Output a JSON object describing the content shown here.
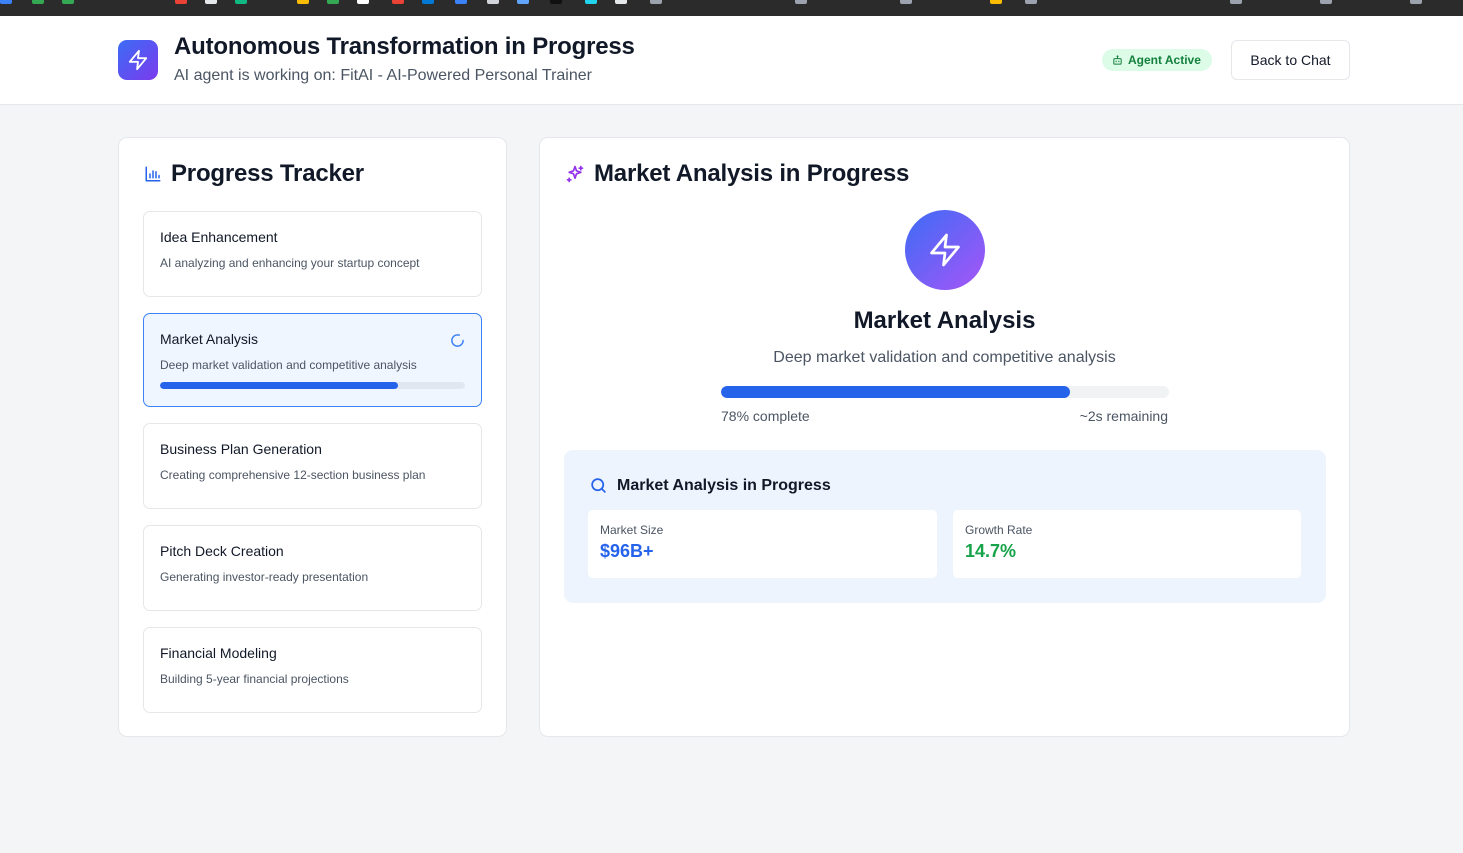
{
  "header": {
    "title": "Autonomous Transformation in Progress",
    "subtitle": "AI agent is working on: FitAI - AI-Powered Personal Trainer",
    "badge": "Agent Active",
    "back_button": "Back to Chat",
    "logo_icon": "lightning-icon",
    "badge_icon": "robot-icon"
  },
  "tracker": {
    "heading": "Progress Tracker",
    "heading_icon": "bar-chart-icon",
    "steps": [
      {
        "title": "Idea Enhancement",
        "desc": "AI analyzing and enhancing your startup concept",
        "status": "pending"
      },
      {
        "title": "Market Analysis",
        "desc": "Deep market validation and competitive analysis",
        "status": "active",
        "progress": 0.78
      },
      {
        "title": "Business Plan Generation",
        "desc": "Creating comprehensive 12-section business plan",
        "status": "pending"
      },
      {
        "title": "Pitch Deck Creation",
        "desc": "Generating investor-ready presentation",
        "status": "pending"
      },
      {
        "title": "Financial Modeling",
        "desc": "Building 5-year financial projections",
        "status": "pending"
      }
    ]
  },
  "current": {
    "heading": "Market Analysis in Progress",
    "heading_icon": "sparkles-icon",
    "phase_title": "Market Analysis",
    "phase_desc": "Deep market validation and competitive analysis",
    "progress": 0.78,
    "progress_label": "78% complete",
    "remaining_label": "~2s remaining",
    "analysis": {
      "heading": "Market Analysis in Progress",
      "heading_icon": "search-icon",
      "metrics": [
        {
          "label": "Market Size",
          "value": "$96B+",
          "color": "#2563eb"
        },
        {
          "label": "Growth Rate",
          "value": "14.7%",
          "color": "#16a34a"
        }
      ]
    }
  },
  "colors": {
    "accent": "#2563eb",
    "active_bg": "#eff6ff",
    "success": "#16a34a",
    "badge_bg": "#dcfce7"
  }
}
